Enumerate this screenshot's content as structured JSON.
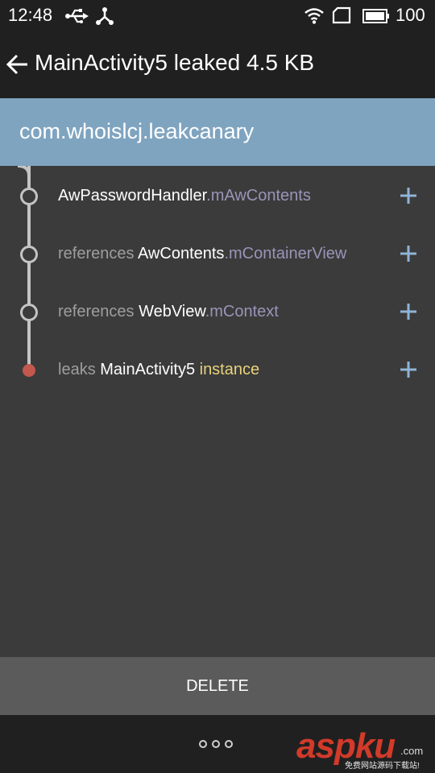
{
  "status_bar": {
    "time": "12:48",
    "battery": "100"
  },
  "app_bar": {
    "title": "MainActivity5 leaked 4.5 KB"
  },
  "header": {
    "package": "com.whoislcj.leakcanary"
  },
  "trace": [
    {
      "prefix": "",
      "class_name": "AwPasswordHandler",
      "field": ".mAwContents",
      "suffix": ""
    },
    {
      "prefix": "references ",
      "class_name": "AwContents",
      "field": ".mContainerView",
      "suffix": ""
    },
    {
      "prefix": "references ",
      "class_name": "WebView",
      "field": ".mContext",
      "suffix": ""
    },
    {
      "prefix": "leaks ",
      "class_name": "MainActivity5",
      "field": "",
      "suffix": " instance"
    }
  ],
  "footer": {
    "delete_label": "DELETE"
  },
  "watermark": {
    "logo": "aspku",
    "domain": ".com",
    "caption": "免费网站源码下载站!"
  },
  "colors": {
    "app_bar": "#202020",
    "header": "#7fa4c0",
    "background": "#3b3b3b",
    "field_text": "#9a94b8",
    "instance_text": "#e7d27c",
    "leak_dot": "#c4574e",
    "expand_icon": "#8fb4d6"
  },
  "icons": [
    "usb-icon",
    "share-icon",
    "wifi-icon",
    "sim-icon",
    "battery-icon",
    "back-arrow-icon",
    "plus-icon",
    "more-icon"
  ]
}
